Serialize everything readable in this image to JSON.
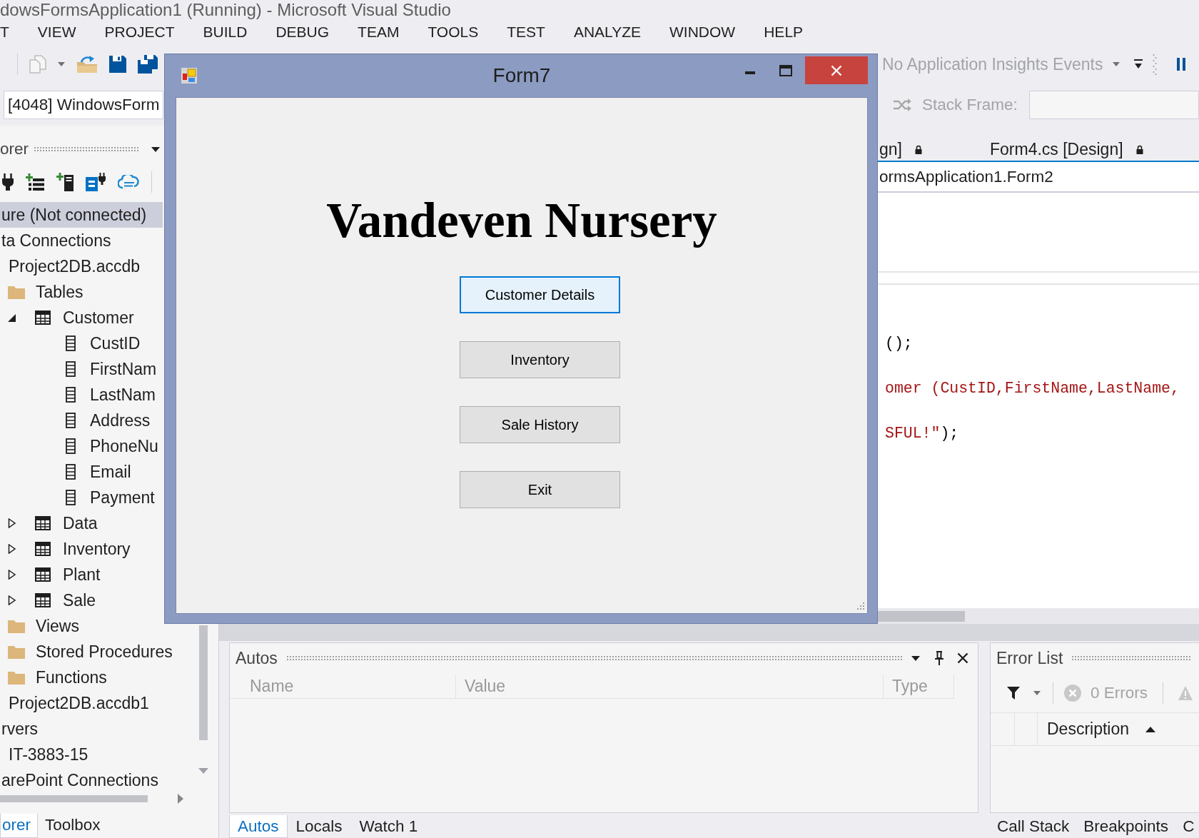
{
  "window": {
    "title": "dowsFormsApplication1 (Running) - Microsoft Visual Studio"
  },
  "menu": [
    "T",
    "VIEW",
    "PROJECT",
    "BUILD",
    "DEBUG",
    "TEAM",
    "TOOLS",
    "TEST",
    "ANALYZE",
    "WINDOW",
    "HELP"
  ],
  "toolbar": {
    "insights_dropdown": {
      "value": "No Application Insights Events",
      "disabled": true
    },
    "process_combo": {
      "value": "[4048] WindowsForm"
    },
    "stack_frame": {
      "label": "Stack Frame:",
      "disabled": true
    }
  },
  "server_explorer": {
    "title": "orer",
    "tree": [
      {
        "label": "ure (Not connected)",
        "selected": true
      },
      {
        "label": "ta Connections",
        "selected": false,
        "children": [
          {
            "label": "Project2DB.accdb",
            "selected": false,
            "children": [
              {
                "label": "Tables",
                "kind": "folder",
                "selected": false,
                "children": [
                  {
                    "label": "Customer",
                    "kind": "table",
                    "expanded": true,
                    "selected": false,
                    "children": [
                      {
                        "label": "CustID",
                        "kind": "column",
                        "selected": false
                      },
                      {
                        "label": "FirstNam",
                        "kind": "column",
                        "selected": false
                      },
                      {
                        "label": "LastNam",
                        "kind": "column",
                        "selected": false
                      },
                      {
                        "label": "Address",
                        "kind": "column",
                        "selected": false
                      },
                      {
                        "label": "PhoneNu",
                        "kind": "column",
                        "selected": false
                      },
                      {
                        "label": "Email",
                        "kind": "column",
                        "selected": false
                      },
                      {
                        "label": "Payment",
                        "kind": "column",
                        "selected": false
                      }
                    ]
                  },
                  {
                    "label": "Data",
                    "kind": "table",
                    "expanded": false,
                    "selected": false
                  },
                  {
                    "label": "Inventory",
                    "kind": "table",
                    "expanded": false,
                    "selected": false
                  },
                  {
                    "label": "Plant",
                    "kind": "table",
                    "expanded": false,
                    "selected": false
                  },
                  {
                    "label": "Sale",
                    "kind": "table",
                    "expanded": false,
                    "selected": false
                  }
                ]
              },
              {
                "label": "Views",
                "kind": "folder",
                "selected": false
              },
              {
                "label": "Stored Procedures",
                "kind": "folder",
                "selected": false
              },
              {
                "label": "Functions",
                "kind": "folder",
                "selected": false
              }
            ]
          },
          {
            "label": "Project2DB.accdb1",
            "selected": false
          }
        ]
      },
      {
        "label": "rvers",
        "selected": false,
        "children": [
          {
            "label": "IT-3883-15",
            "selected": false
          }
        ]
      },
      {
        "label": "arePoint Connections",
        "selected": false
      }
    ],
    "tabs": [
      {
        "label": "orer",
        "selected": true
      },
      {
        "label": "Toolbox",
        "selected": false
      }
    ]
  },
  "editor": {
    "tabs": [
      {
        "label": "gn]",
        "selected": false
      },
      {
        "label": "Form4.cs [Design]",
        "selected": false
      }
    ],
    "type_dropdown": {
      "value": "ormsApplication1.Form2"
    },
    "code_lines": [
      [
        {
          "kind": "plain",
          "text": "();"
        }
      ],
      [
        {
          "kind": "string",
          "text": "omer (CustID,FirstName,LastName,"
        }
      ],
      [
        {
          "kind": "string",
          "text": "SFUL!\""
        },
        {
          "kind": "plain",
          "text": ");"
        }
      ]
    ]
  },
  "form": {
    "title": "Form7",
    "heading": "Vandeven Nursery",
    "buttons": [
      {
        "label": "Customer Details",
        "focused": true
      },
      {
        "label": "Inventory",
        "focused": false
      },
      {
        "label": "Sale History",
        "focused": false
      },
      {
        "label": "Exit",
        "focused": false
      }
    ]
  },
  "autos": {
    "title": "Autos",
    "columns": [
      "Name",
      "Value",
      "Type"
    ],
    "tabs": [
      {
        "label": "Autos",
        "selected": true
      },
      {
        "label": "Locals",
        "selected": false
      },
      {
        "label": "Watch 1",
        "selected": false
      }
    ]
  },
  "error_list": {
    "title": "Error List",
    "errors": {
      "label": "0 Errors",
      "disabled": true
    },
    "columns": [
      {
        "label": "Description",
        "sorted": true
      }
    ],
    "tabs": [
      {
        "label": "Call Stack",
        "selected": false
      },
      {
        "label": "Breakpoints",
        "selected": false
      },
      {
        "label": "C",
        "selected": false
      }
    ]
  }
}
